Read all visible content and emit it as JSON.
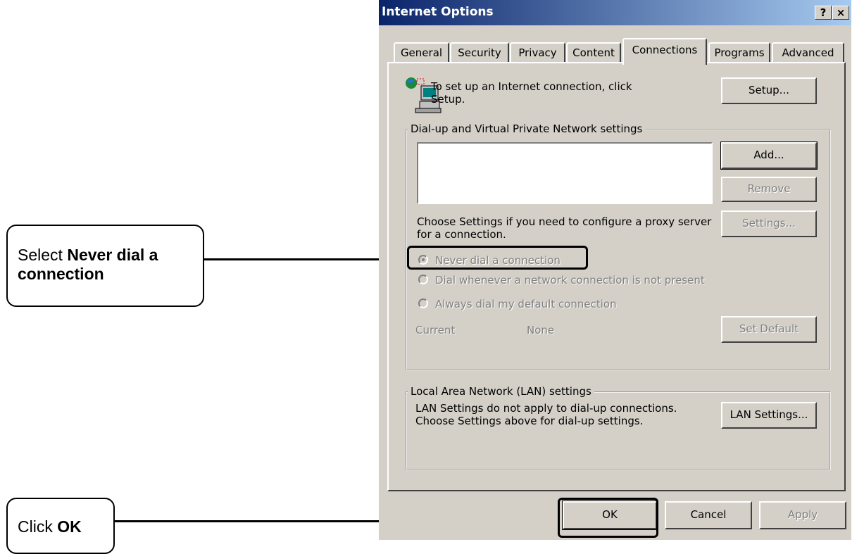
{
  "callouts": {
    "never_dial": {
      "prefix": "Select ",
      "bold": "Never dial a connection"
    },
    "ok": {
      "prefix": "Click ",
      "bold": "OK"
    }
  },
  "dialog": {
    "title": "Internet Options",
    "help_label": "?",
    "close_label": "×",
    "tabs": [
      {
        "label": "General"
      },
      {
        "label": "Security"
      },
      {
        "label": "Privacy"
      },
      {
        "label": "Content"
      },
      {
        "label": "Connections",
        "active": true
      },
      {
        "label": "Programs"
      },
      {
        "label": "Advanced"
      }
    ],
    "setup": {
      "icon": "network-computer-icon",
      "text": "To set up an Internet connection, click Setup.",
      "button": "Setup..."
    },
    "dialup_group": {
      "legend": "Dial-up and Virtual Private Network settings",
      "add": "Add...",
      "remove": "Remove",
      "proxy_text": "Choose Settings if you need to configure a proxy server for a connection.",
      "settings": "Settings...",
      "options": [
        {
          "label": "Never dial a connection",
          "selected": true
        },
        {
          "label": "Dial whenever a network connection is not present",
          "selected": false
        },
        {
          "label": "Always dial my default connection",
          "selected": false
        }
      ],
      "current_label": "Current",
      "current_value": "None",
      "set_default": "Set Default"
    },
    "lan_group": {
      "legend": "Local Area Network (LAN) settings",
      "text": "LAN Settings do not apply to dial-up connections. Choose Settings above for dial-up settings.",
      "button": "LAN Settings..."
    },
    "footer": {
      "ok": "OK",
      "cancel": "Cancel",
      "apply": "Apply"
    }
  }
}
